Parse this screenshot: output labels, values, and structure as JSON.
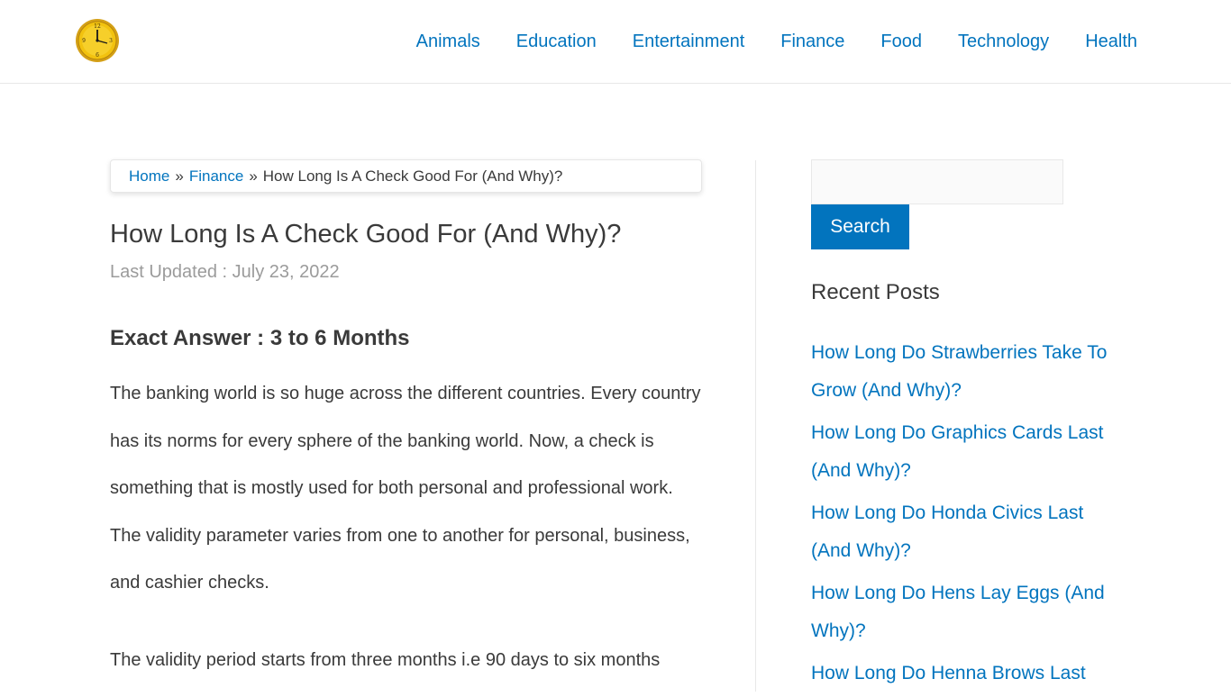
{
  "header": {
    "nav": [
      "Animals",
      "Education",
      "Entertainment",
      "Finance",
      "Food",
      "Technology",
      "Health"
    ]
  },
  "breadcrumb": {
    "home": "Home",
    "separator": "»",
    "category": "Finance",
    "current": "How Long Is A Check Good For (And Why)?"
  },
  "article": {
    "title": "How Long Is A Check Good For (And Why)?",
    "updated": "Last Updated : July 23, 2022",
    "answer": "Exact Answer : 3 to 6 Months",
    "paragraphs": [
      "The banking world is so huge across the different countries. Every country has its norms for every sphere of the banking world. Now, a check is something that is mostly used for both personal and professional work. The validity parameter varies from one to another for personal, business, and cashier checks.",
      "The validity period starts from three months i.e 90 days to six months"
    ]
  },
  "sidebar": {
    "search_placeholder": "",
    "search_button": "Search",
    "recent_heading": "Recent Posts",
    "recent_posts": [
      "How Long Do Strawberries Take To Grow (And Why)?",
      "How Long Do Graphics Cards Last (And Why)?",
      "How Long Do Honda Civics Last (And Why)?",
      "How Long Do Hens Lay Eggs (And Why)?",
      "How Long Do Henna Brows Last"
    ]
  },
  "colors": {
    "link": "#0274be",
    "text": "#3a3a3a",
    "muted": "#9b9b9b",
    "button": "#0274be"
  }
}
